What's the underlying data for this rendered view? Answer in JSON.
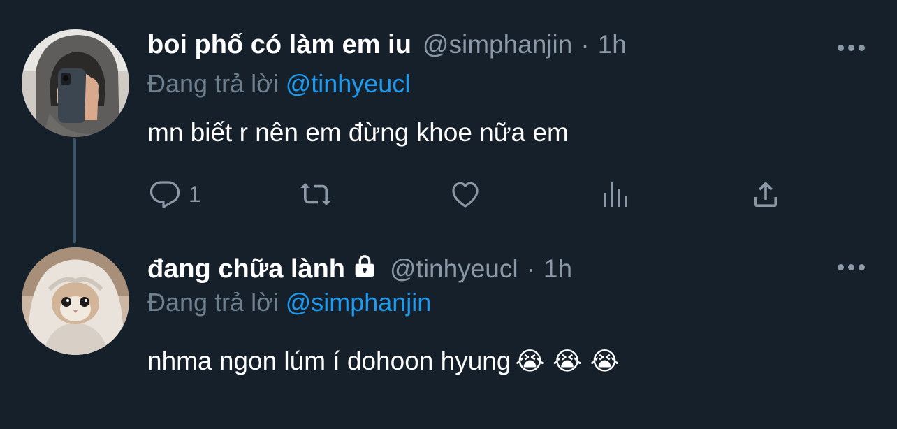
{
  "tweets": [
    {
      "display_name": "boi phố có làm em iu",
      "handle": "@simphanjin",
      "separator": "·",
      "time": "1h",
      "replying_prefix": "Đang trả lời",
      "replying_to": "@tinhyeucl",
      "text": "mn biết r nên em đừng khoe nữa em",
      "reply_count": "1",
      "icons": [
        "reply-icon",
        "retweet-icon",
        "like-icon",
        "analytics-icon",
        "share-icon",
        "more-icon"
      ]
    },
    {
      "display_name": "đang chữa lành",
      "handle": "@tinhyeucl",
      "separator": "·",
      "time": "1h",
      "replying_prefix": "Đang trả lời",
      "replying_to": "@simphanjin",
      "text": "nhma ngon lúm í dohoon hyung",
      "emojis": "😭 😭 😭",
      "protected": true,
      "icons": [
        "lock-icon",
        "more-icon"
      ]
    }
  ],
  "colors": {
    "background": "#15202b",
    "text_primary": "#ffffff",
    "text_secondary": "#8b98a5",
    "mention": "#1d9bf0",
    "thread_line": "#3d5466"
  }
}
